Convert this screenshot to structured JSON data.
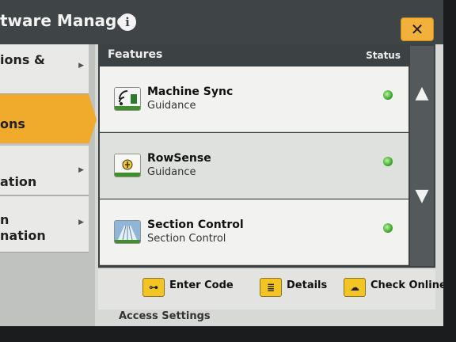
{
  "titlebar": {
    "title": "tware Manager",
    "close_label": "✕"
  },
  "left_nav": [
    {
      "label": "ions &",
      "active": false
    },
    {
      "label": "ons",
      "active": true
    },
    {
      "label": "ation",
      "active": false
    },
    {
      "label": "n\nnation",
      "active": false
    }
  ],
  "panel": {
    "header_features": "Features",
    "header_status": "Status",
    "rows": [
      {
        "name": "Machine Sync",
        "sub": "Guidance",
        "icon": "machine-sync-icon",
        "status": "active"
      },
      {
        "name": "RowSense",
        "sub": "Guidance",
        "icon": "rowsense-icon",
        "status": "active"
      },
      {
        "name": "Section Control",
        "sub": "Section Control",
        "icon": "section-control-icon",
        "status": "active"
      }
    ]
  },
  "bottom": {
    "enter_code": "Enter Code",
    "details": "Details",
    "check_online": "Check Online"
  },
  "below": {
    "text": "Access     Settings"
  },
  "colors": {
    "accent": "#f0aa2c",
    "titlebar": "#3f4446",
    "status_green": "#3fa82a"
  }
}
